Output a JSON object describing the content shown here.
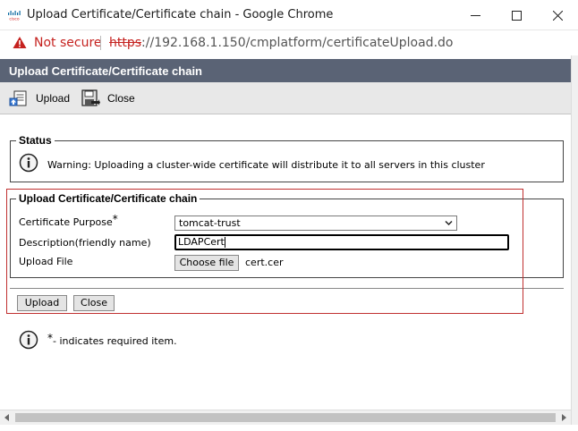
{
  "window": {
    "title": "Upload Certificate/Certificate chain - Google Chrome"
  },
  "addressbar": {
    "security_label": "Not secure",
    "url_scheme": "https",
    "url_rest": "://192.168.1.150/cmplatform/certificateUpload.do"
  },
  "page": {
    "header_title": "Upload Certificate/Certificate chain"
  },
  "toolbar": {
    "upload_label": "Upload",
    "close_label": "Close"
  },
  "status": {
    "legend": "Status",
    "message": "Warning: Uploading a cluster-wide certificate will distribute it to all servers in this cluster"
  },
  "form": {
    "legend": "Upload Certificate/Certificate chain",
    "purpose_label": "Certificate Purpose",
    "required_mark": "*",
    "purpose_value": "tomcat-trust",
    "description_label": "Description(friendly name)",
    "description_value": "LDAPCert",
    "file_label": "Upload File",
    "choose_file_label": "Choose file",
    "file_name": "cert.cer"
  },
  "actions": {
    "upload_label": "Upload",
    "close_label": "Close"
  },
  "footer": {
    "required_mark": "*",
    "required_note": "- indicates required item."
  },
  "colors": {
    "header_bg": "#5a6375",
    "not_secure": "#c5221f",
    "highlight_border": "#c03030"
  },
  "icons": {
    "favicon": "cisco-logo-icon",
    "security": "warning-triangle-icon",
    "upload": "upload-document-icon",
    "close": "close-save-icon",
    "info": "info-icon"
  }
}
